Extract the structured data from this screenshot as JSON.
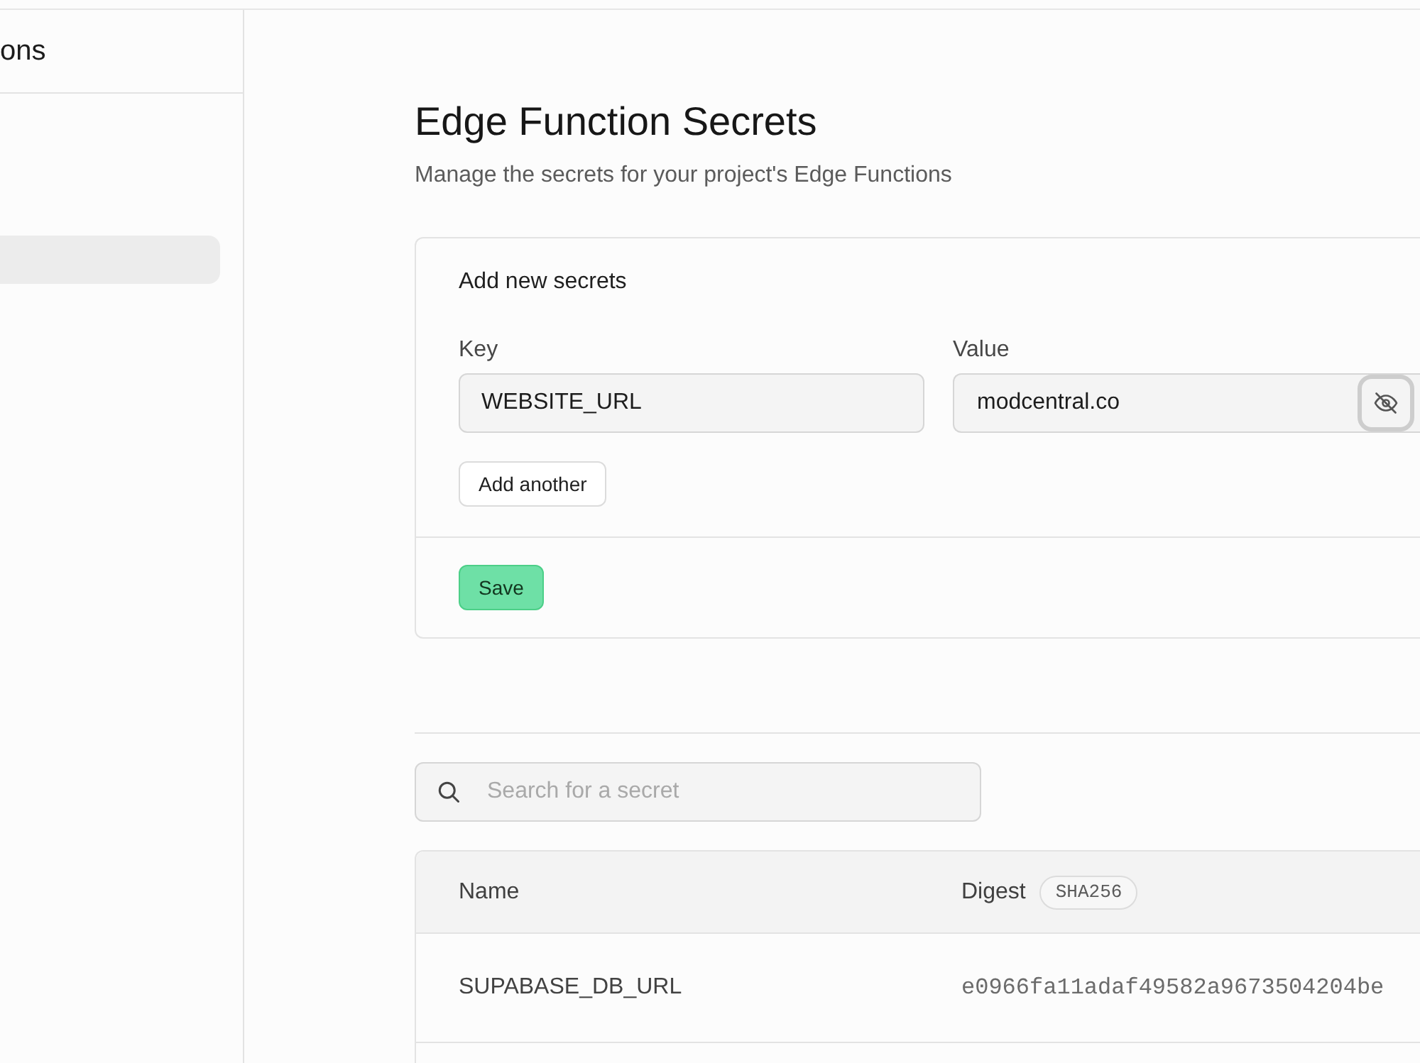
{
  "sidebar": {
    "title": "ons",
    "items": [
      {
        "selected": true
      }
    ]
  },
  "header": {
    "title": "Edge Function Secrets",
    "subtitle": "Manage the secrets for your project's Edge Functions"
  },
  "new_secrets": {
    "title": "Add new secrets",
    "fields": [
      {
        "kind": "text",
        "label": "Key",
        "value": "WEBSITE_URL"
      },
      {
        "kind": "secret",
        "label": "Value",
        "value": "modcentral.co",
        "revealed": true,
        "toggle_focused": true
      }
    ],
    "add_button": "Add another",
    "save_button": "Save"
  },
  "search": {
    "placeholder": "Search for a secret"
  },
  "table": {
    "columns": [
      {
        "label": "Name"
      },
      {
        "label": "Digest",
        "badge": "SHA256"
      }
    ],
    "rows": [
      {
        "name": "SUPABASE_DB_URL",
        "digest": "e0966fa11adaf49582a9673504204be"
      }
    ]
  }
}
